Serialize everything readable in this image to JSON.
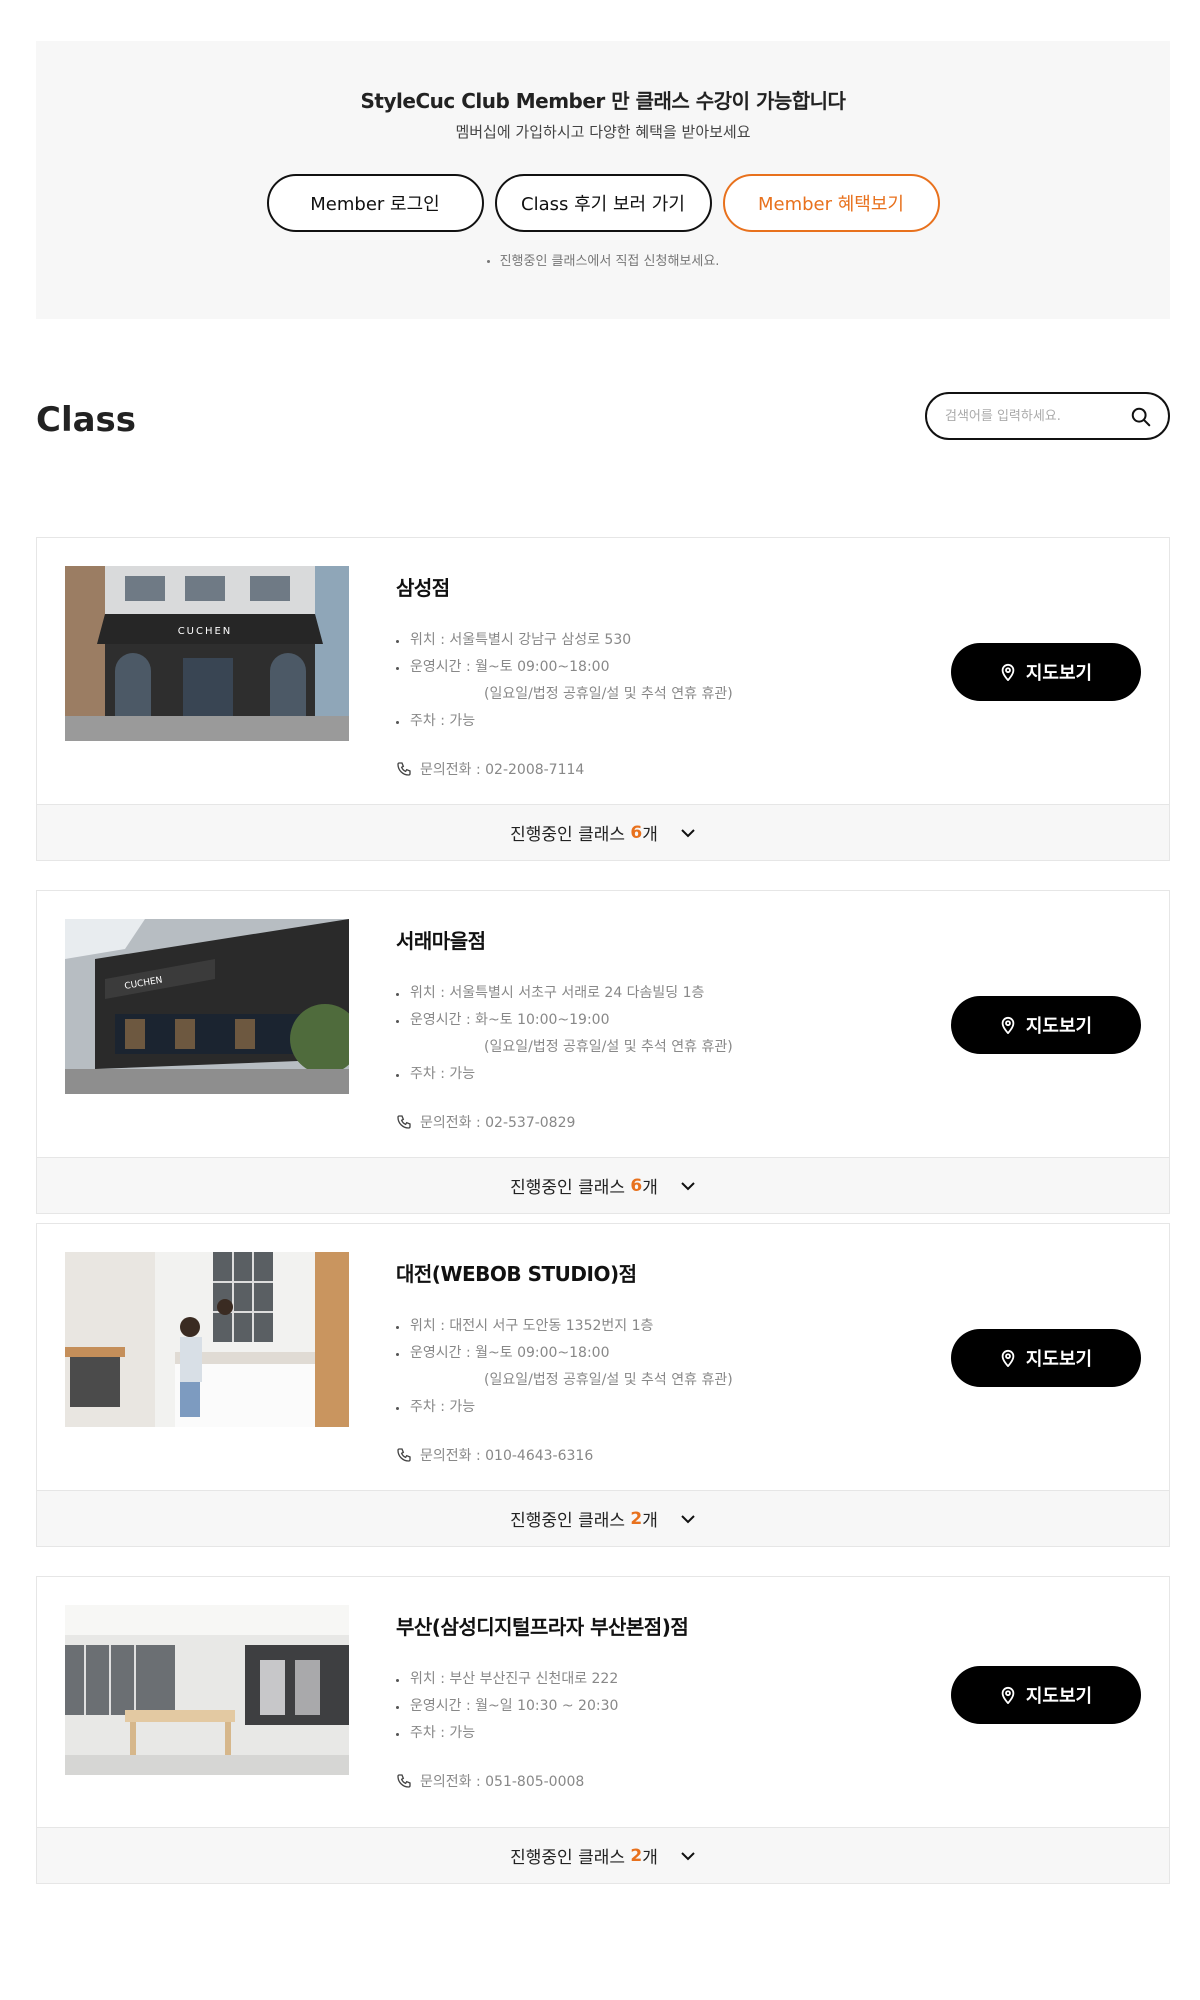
{
  "banner": {
    "title": "StyleCuc Club Member 만 클래스 수강이 가능합니다",
    "subtitle": "멤버십에 가입하시고 다양한 혜택을 받아보세요",
    "buttons": [
      "Member 로그인",
      "Class 후기 보러 가기",
      "Member 혜택보기"
    ],
    "note": "진행중인 클래스에서 직접 신청해보세요.",
    "accent_color": "#e8711d"
  },
  "class_section": {
    "title": "Class",
    "search_placeholder": "검색어를 입력하세요."
  },
  "labels": {
    "map_button": "지도보기",
    "classes_prefix": "진행중인 클래스",
    "classes_suffix": "개"
  },
  "stores": [
    {
      "name": "삼성점",
      "location": "위치 : 서울특별시 강남구 삼성로 530",
      "hours": "운영시간 : 월~토 09:00~18:00",
      "holiday": "(일요일/법정 공휴일/설 및 추석 연휴 휴관)",
      "parking": "주차 : 가능",
      "phone": "문의전화 : 02-2008-7114",
      "class_count": "6",
      "image": "storefront-cuchen-samsung"
    },
    {
      "name": "서래마을점",
      "location": "위치 : 서울특별시 서초구 서래로 24 다솜빌딩 1층",
      "hours": "운영시간 : 화~토 10:00~19:00",
      "holiday": "(일요일/법정 공휴일/설 및 추석 연휴 휴관)",
      "parking": "주차 : 가능",
      "phone": "문의전화 : 02-537-0829",
      "class_count": "6",
      "image": "storefront-cuchen-experience-center"
    },
    {
      "name": "대전(WEBOB STUDIO)점",
      "location": "위치 : 대전시 서구 도안동 1352번지 1층",
      "hours": "운영시간 : 월~토 09:00~18:00",
      "holiday": "(일요일/법정 공휴일/설 및 추석 연휴 휴관)",
      "parking": "주차 : 가능",
      "phone": "문의전화 : 010-4643-6316",
      "class_count": "2",
      "image": "kitchen-studio-interior"
    },
    {
      "name": "부산(삼성디지털프라자 부산본점)점",
      "location": "위치 : 부산 부산진구 신천대로 222",
      "hours": "운영시간 : 월~일 10:30 ~ 20:30",
      "parking": "주차 : 가능",
      "phone": "문의전화 : 051-805-0008",
      "class_count": "2",
      "image": "showroom-interior"
    }
  ]
}
